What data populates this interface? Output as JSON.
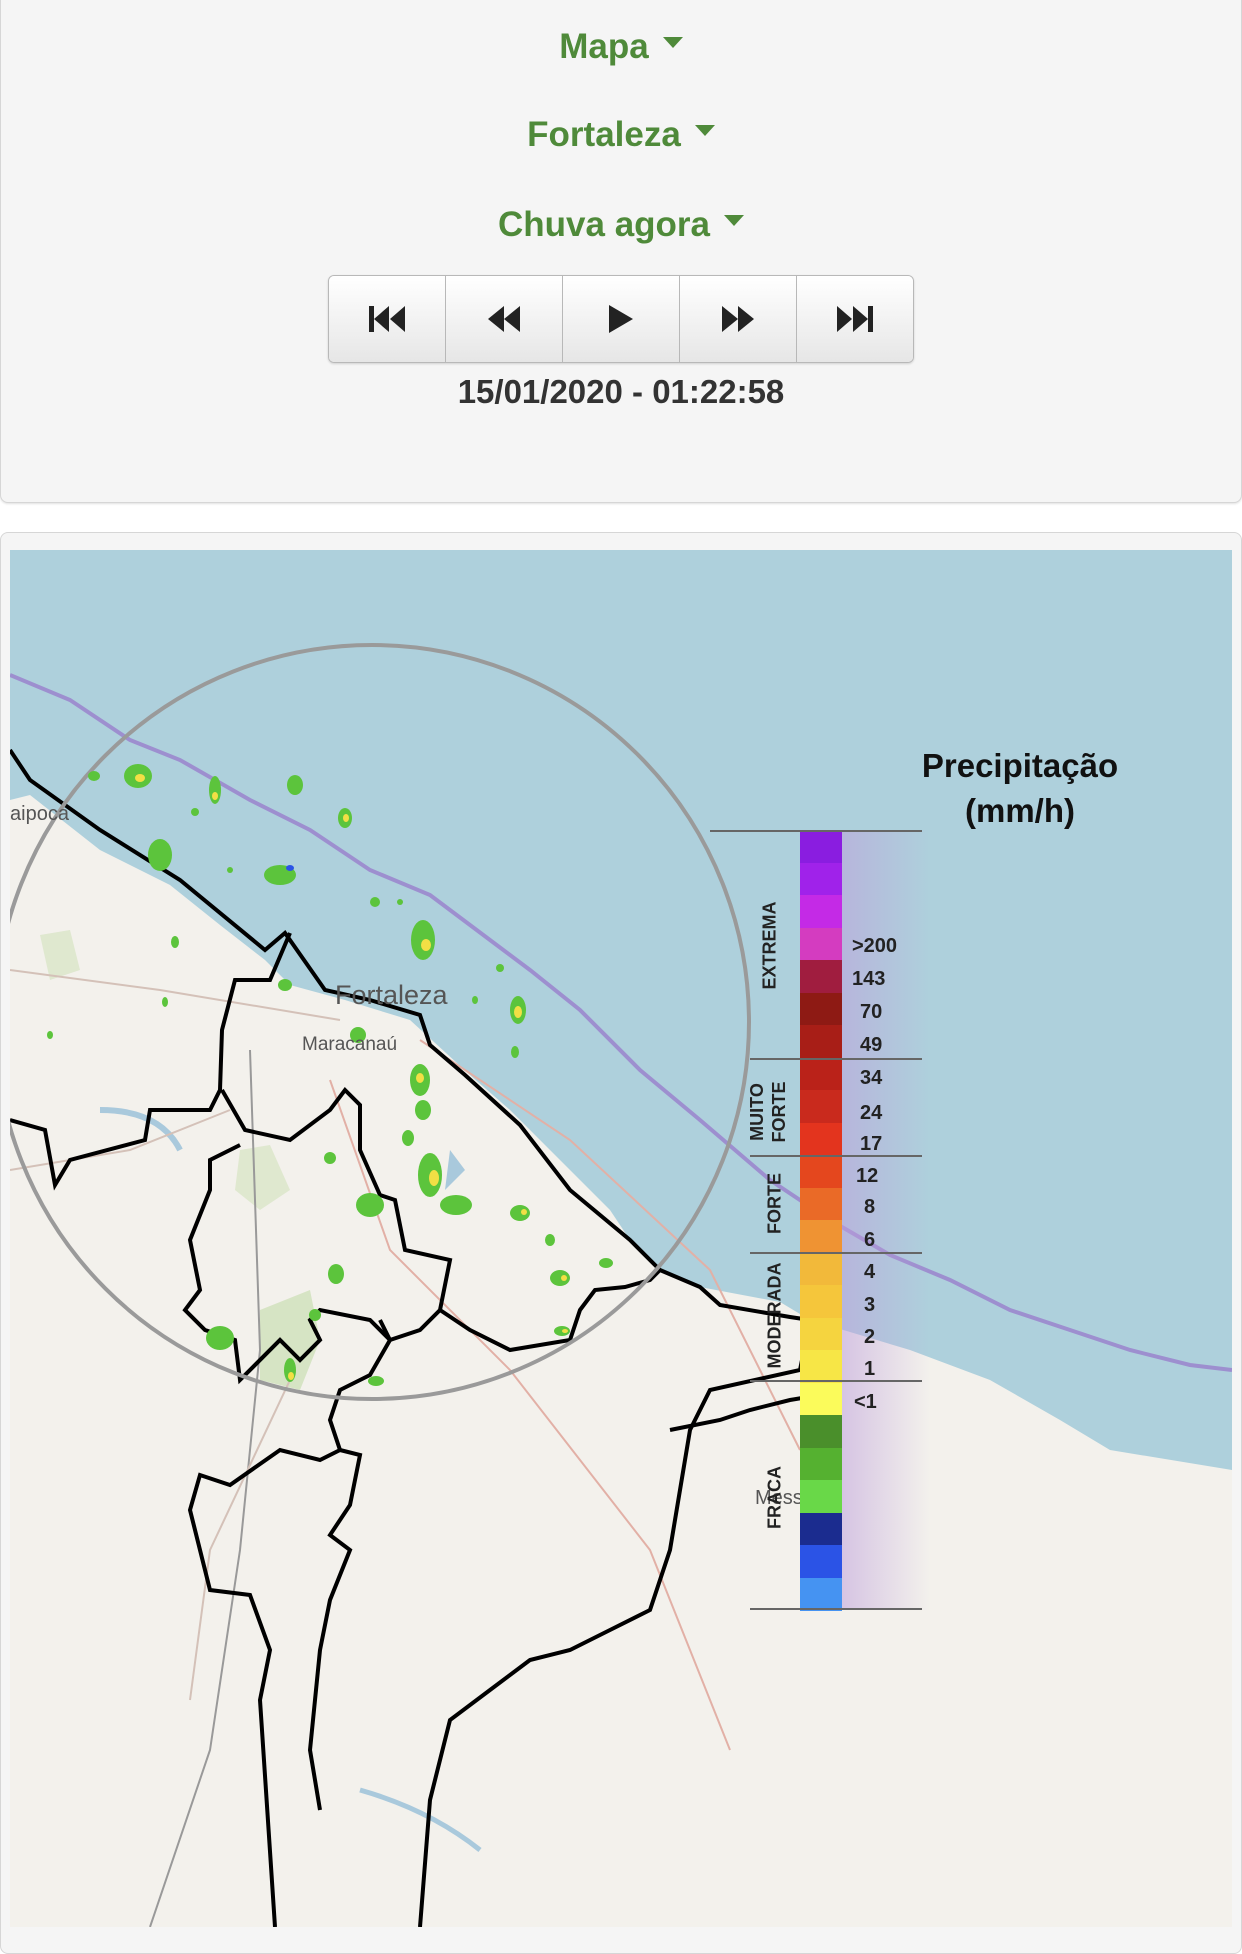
{
  "controls": {
    "view_dropdown": "Mapa",
    "location_dropdown": "Fortaleza",
    "product_dropdown": "Chuva agora",
    "timestamp": "15/01/2020 - 01:22:58"
  },
  "player_icons": [
    "skip-first-icon",
    "rewind-icon",
    "play-icon",
    "fast-forward-icon",
    "skip-last-icon"
  ],
  "map": {
    "city_labels": {
      "fortaleza": "Fortaleza",
      "maracanau": "Maracanaú",
      "paraipoca": "aipoca",
      "messejana": "Mess"
    },
    "colors": {
      "sea": "#aed0dc",
      "land": "#f3f1ec",
      "border": "#000000",
      "radar_ring": "#9a9a9a",
      "coast_line": "#9d8fcf"
    }
  },
  "legend": {
    "title_line1": "Precipitação",
    "title_line2": "(mm/h)",
    "categories": {
      "extrema": "EXTREMA",
      "muito": "MUITO",
      "forte_muito": "FORTE",
      "forte": "FORTE",
      "moderada": "MODERADA",
      "fraca": "FRACA"
    },
    "values": {
      "v200": ">200",
      "v143": "143",
      "v70": "70",
      "v49": "49",
      "v34": "34",
      "v24": "24",
      "v17": "17",
      "v12": "12",
      "v8": "8",
      "v6": "6",
      "v4": "4",
      "v3": "3",
      "v2": "2",
      "v1": "1",
      "vlt1": "<1"
    },
    "colors": [
      "#8a1de0",
      "#a022ea",
      "#c42ae6",
      "#d43cc0",
      "#a01d3f",
      "#8e1a14",
      "#a81e17",
      "#ba2219",
      "#c92a1d",
      "#e3341e",
      "#e4471e",
      "#ea6a27",
      "#ef9333",
      "#f2b93a",
      "#f5c63b",
      "#f5d43f",
      "#f7e646",
      "#fbfb5b",
      "#4a8f2b",
      "#55b130",
      "#69d848",
      "#1b2c8f",
      "#2b53e6",
      "#4593f2"
    ]
  }
}
